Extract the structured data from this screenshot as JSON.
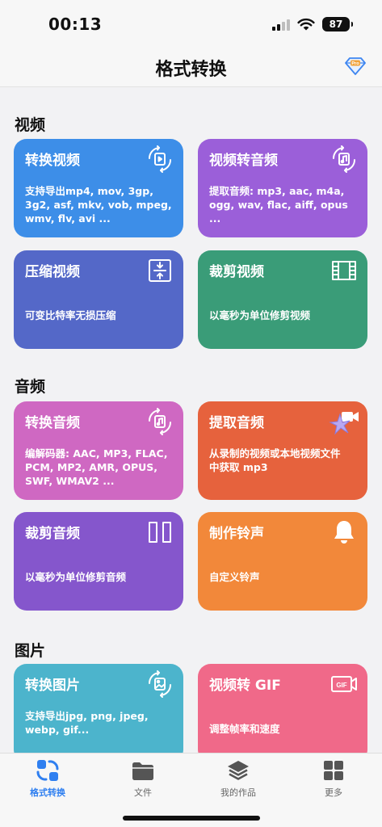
{
  "status_bar": {
    "time": "00:13",
    "battery": "87"
  },
  "nav": {
    "title": "格式转换",
    "pro_badge": "Pro"
  },
  "sections": [
    {
      "title": "视频"
    },
    {
      "title": "音频"
    },
    {
      "title": "图片"
    }
  ],
  "cards": [
    {
      "title": "转换视频",
      "desc": "支持导出mp4, mov, 3gp,\n3g2, asf, mkv, vob, mpeg,\nwmv, flv, avi ...",
      "icon": "convert-video-icon",
      "color": "#3d8ee8"
    },
    {
      "title": "视频转音频",
      "desc": "提取音频: mp3, aac, m4a,\nogg, wav, flac, aiff, opus ...",
      "icon": "video-to-audio-icon",
      "color": "#9b5fd9"
    },
    {
      "title": "压缩视频",
      "desc": "可变比特率无损压缩",
      "icon": "compress-icon",
      "color": "#5468c8"
    },
    {
      "title": "裁剪视频",
      "desc": "以毫秒为单位修剪视频",
      "icon": "film-strip-icon",
      "color": "#3a9c78"
    },
    {
      "title": "转换音频",
      "desc": "编解码器: AAC, MP3, FLAC,\nPCM, MP2, AMR, OPUS,\nSWF, WMAV2 ...",
      "icon": "convert-audio-icon",
      "color": "#cf68c2"
    },
    {
      "title": "提取音频",
      "desc": "从录制的视频或本地视频文件\n中获取 mp3",
      "icon": "extract-audio-icon",
      "color": "#e6623d"
    },
    {
      "title": "裁剪音频",
      "desc": "以毫秒为单位修剪音频",
      "icon": "trim-audio-icon",
      "color": "#8556cc"
    },
    {
      "title": "制作铃声",
      "desc": "自定义铃声",
      "icon": "bell-icon",
      "color": "#f2883a"
    },
    {
      "title": "转换图片",
      "desc": "支持导出jpg, png, jpeg,\nwebp, gif...",
      "icon": "convert-image-icon",
      "color": "#4cb4cc"
    },
    {
      "title": "视频转 GIF",
      "desc": "调整帧率和速度",
      "icon": "gif-icon",
      "color": "#f06989"
    }
  ],
  "tabs": [
    {
      "label": "格式转换",
      "icon": "convert-tab-icon",
      "active": true
    },
    {
      "label": "文件",
      "icon": "folder-icon",
      "active": false
    },
    {
      "label": "我的作品",
      "icon": "layers-icon",
      "active": false
    },
    {
      "label": "更多",
      "icon": "grid-icon",
      "active": false
    }
  ]
}
